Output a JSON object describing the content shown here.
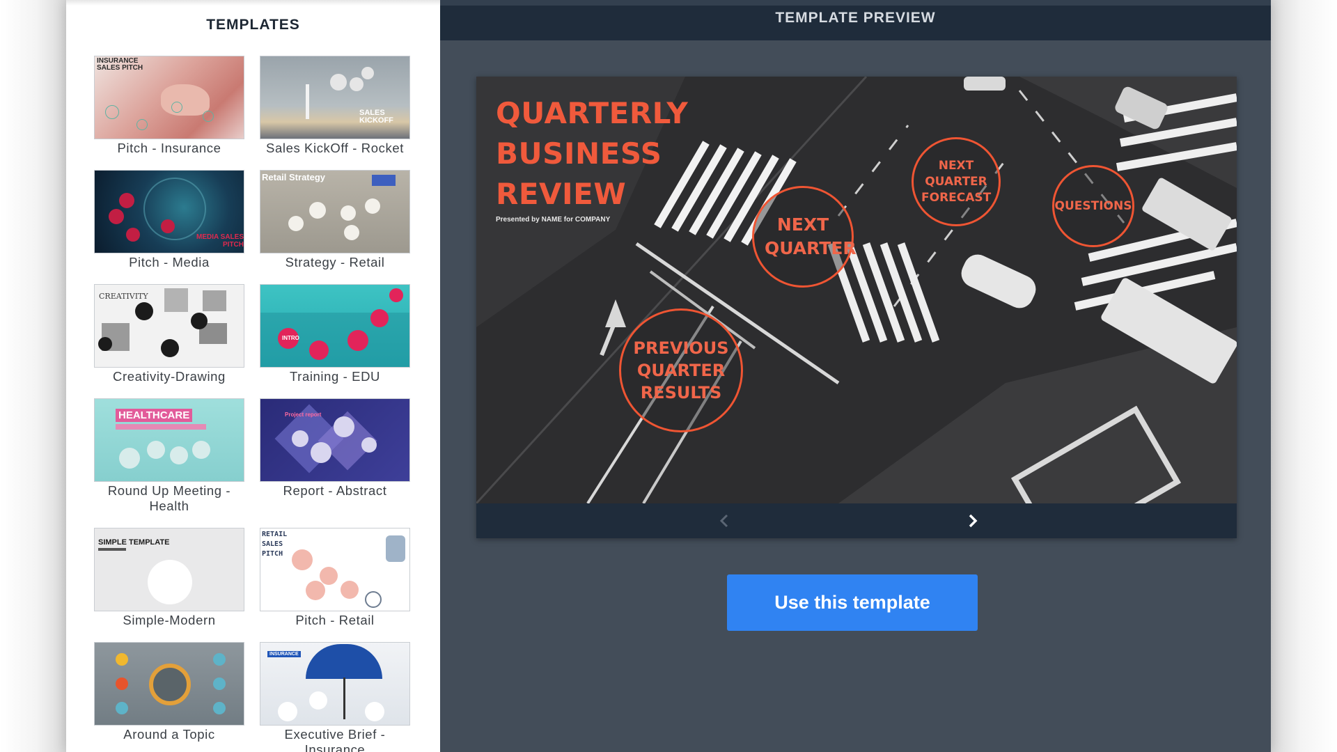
{
  "templates_panel": {
    "title": "TEMPLATES",
    "items": [
      {
        "label": "Pitch - Insurance",
        "thumb_text": "INSURANCE SALES PITCH"
      },
      {
        "label": "Sales KickOff - Rocket",
        "thumb_text": "SALES KICKOFF"
      },
      {
        "label": "Pitch - Media",
        "thumb_text": "MEDIA SALES PITCH"
      },
      {
        "label": "Strategy - Retail",
        "thumb_text": "Retail Strategy"
      },
      {
        "label": "Creativity-Drawing",
        "thumb_text": "CREATIVITY"
      },
      {
        "label": "Training - EDU",
        "thumb_text": "INTRO"
      },
      {
        "label": "Round Up Meeting - Health",
        "thumb_text": "HEALTHCARE"
      },
      {
        "label": "Report - Abstract",
        "thumb_text": "Project report"
      },
      {
        "label": "Simple-Modern",
        "thumb_text": "SIMPLE TEMPLATE"
      },
      {
        "label": "Pitch - Retail",
        "thumb_text": "RETAIL SALES PITCH"
      },
      {
        "label": "Around a Topic",
        "thumb_text": ""
      },
      {
        "label": "Executive Brief - Insurance",
        "thumb_text": "INSURANCE"
      }
    ]
  },
  "preview": {
    "title": "TEMPLATE PREVIEW",
    "slide": {
      "title": "QUARTERLY BUSINESS REVIEW",
      "subtitle": "Presented by NAME for COMPANY",
      "topics": [
        "NEXT QUARTER",
        "NEXT QUARTER FORECAST",
        "QUESTIONS",
        "PREVIOUS QUARTER RESULTS"
      ]
    },
    "nav": {
      "prev_icon": "chevron-left-icon",
      "next_icon": "chevron-right-icon"
    },
    "use_button_label": "Use this template"
  },
  "colors": {
    "accent_blue": "#3083f2",
    "preview_bg": "#434d59",
    "header_bg": "#1f2c3b",
    "slide_accent": "#f05a3c"
  }
}
